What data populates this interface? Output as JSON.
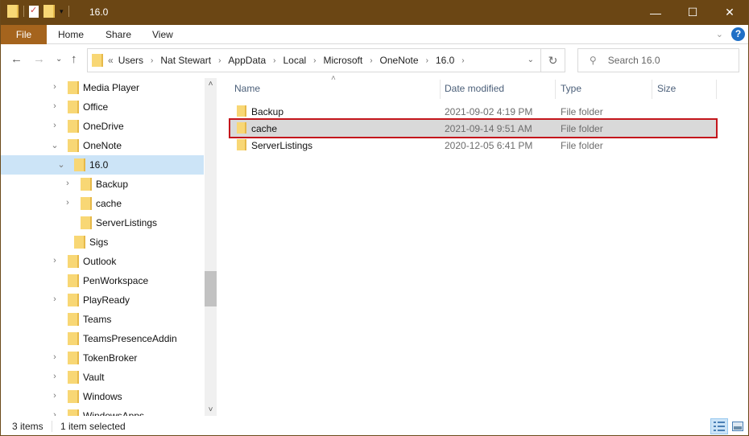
{
  "titlebar": {
    "title": "16.0",
    "qat_icons": [
      "folder-icon",
      "properties-icon",
      "new-folder-icon",
      "customize-dropdown-icon"
    ],
    "minimize_glyph": "—",
    "maximize_glyph": "☐",
    "close_glyph": "✕"
  },
  "ribbon": {
    "tabs": [
      {
        "label": "File",
        "active": true
      },
      {
        "label": "Home"
      },
      {
        "label": "Share"
      },
      {
        "label": "View"
      }
    ],
    "expand_glyph": "⌄",
    "help_glyph": "?"
  },
  "nav": {
    "back_glyph": "←",
    "forward_glyph": "→",
    "recent_glyph": "⌄",
    "up_glyph": "↑",
    "overflow_glyph": "«",
    "breadcrumb": [
      "Users",
      "Nat Stewart",
      "AppData",
      "Local",
      "Microsoft",
      "OneNote",
      "16.0"
    ],
    "crumb_sep": "›",
    "dropdown_glyph": "⌄",
    "refresh_glyph": "↻",
    "search_placeholder": "Search 16.0",
    "search_glyph": "⚲"
  },
  "sidebar": {
    "items": [
      {
        "label": "Media Player",
        "chevron": "›",
        "level": 0
      },
      {
        "label": "Office",
        "chevron": "›",
        "level": 0
      },
      {
        "label": "OneDrive",
        "chevron": "›",
        "level": 0
      },
      {
        "label": "OneNote",
        "chevron": "⌄",
        "level": 0
      },
      {
        "label": "16.0",
        "chevron": "⌄",
        "level": 1,
        "selected": true
      },
      {
        "label": "Backup",
        "chevron": "›",
        "level": 2
      },
      {
        "label": "cache",
        "chevron": "›",
        "level": 2
      },
      {
        "label": "ServerListings",
        "chevron": "",
        "level": 2
      },
      {
        "label": "Sigs",
        "chevron": "",
        "level": 1
      },
      {
        "label": "Outlook",
        "chevron": "›",
        "level": 0
      },
      {
        "label": "PenWorkspace",
        "chevron": "",
        "level": 0
      },
      {
        "label": "PlayReady",
        "chevron": "›",
        "level": 0
      },
      {
        "label": "Teams",
        "chevron": "",
        "level": 0
      },
      {
        "label": "TeamsPresenceAddin",
        "chevron": "",
        "level": 0
      },
      {
        "label": "TokenBroker",
        "chevron": "›",
        "level": 0
      },
      {
        "label": "Vault",
        "chevron": "›",
        "level": 0
      },
      {
        "label": "Windows",
        "chevron": "›",
        "level": 0
      },
      {
        "label": "WindowsApps",
        "chevron": "›",
        "level": 0
      }
    ],
    "scroll_up_glyph": "˄",
    "scroll_down_glyph": "˅"
  },
  "filelist": {
    "columns": [
      "Name",
      "Date modified",
      "Type",
      "Size"
    ],
    "sort_glyph": "˄",
    "rows": [
      {
        "name": "Backup",
        "date": "2021-09-02 4:19 PM",
        "type": "File folder",
        "size": ""
      },
      {
        "name": "cache",
        "date": "2021-09-14 9:51 AM",
        "type": "File folder",
        "size": "",
        "selected": true
      },
      {
        "name": "ServerListings",
        "date": "2020-12-05 6:41 PM",
        "type": "File folder",
        "size": ""
      }
    ]
  },
  "statusbar": {
    "item_count": "3 items",
    "selection": "1 item selected"
  },
  "colors": {
    "titlebar": "#6b4614",
    "file_tab": "#a5641d",
    "selection": "#cce4f7",
    "highlight_box": "#c4161c"
  }
}
